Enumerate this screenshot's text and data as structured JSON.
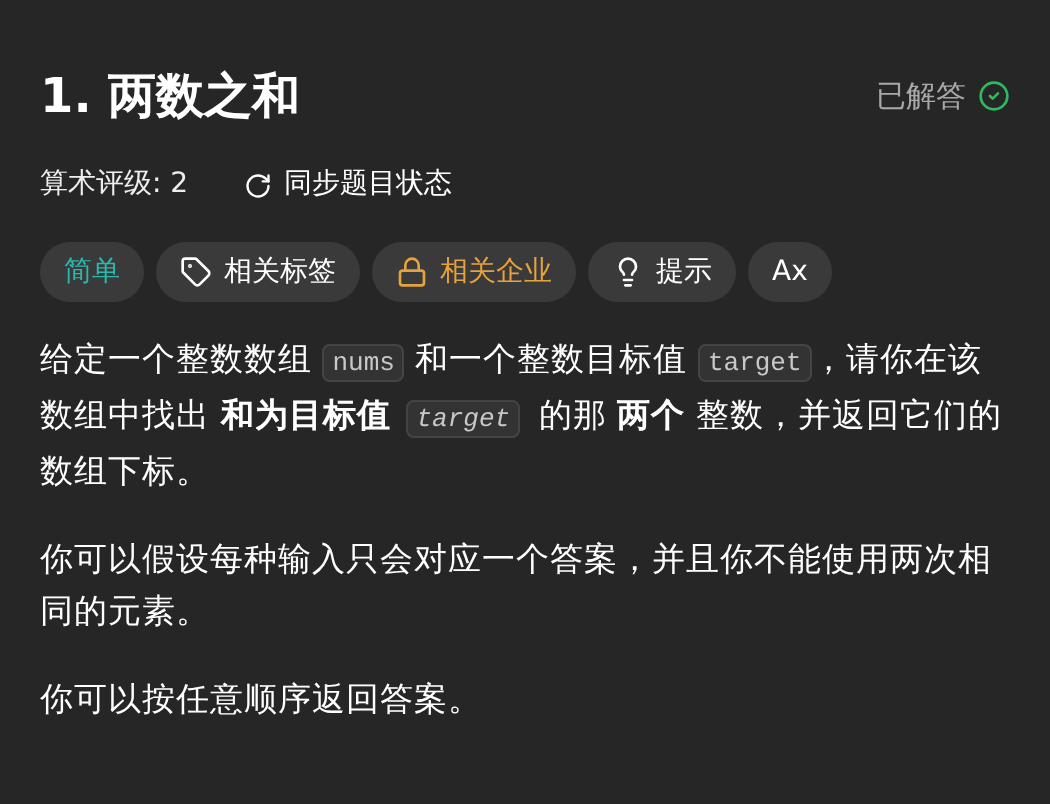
{
  "title": "1. 两数之和",
  "status": {
    "label": "已解答",
    "solved": true
  },
  "rating": {
    "label": "算术评级: 2"
  },
  "sync": {
    "label": "同步题目状态"
  },
  "tags": [
    {
      "kind": "difficulty",
      "label": "简单"
    },
    {
      "kind": "topics",
      "label": "相关标签"
    },
    {
      "kind": "companies",
      "label": "相关企业"
    },
    {
      "kind": "hint",
      "label": "提示"
    },
    {
      "kind": "translate",
      "label": "Ax"
    }
  ],
  "paragraphs": [
    [
      {
        "kind": "text",
        "text": "给定一个整数数组 "
      },
      {
        "kind": "code",
        "text": "nums"
      },
      {
        "kind": "text",
        "text": " 和一个整数目标值 "
      },
      {
        "kind": "code",
        "text": "target"
      },
      {
        "kind": "text",
        "text": "，请你在该数组中找出 "
      },
      {
        "kind": "bold",
        "text": "和为目标值"
      },
      {
        "kind": "code_italic",
        "text": "target"
      },
      {
        "kind": "text",
        "text": " 的那 "
      },
      {
        "kind": "bold",
        "text": "两个"
      },
      {
        "kind": "text",
        "text": " 整数，并返回它们的数组下标。"
      }
    ],
    [
      {
        "kind": "text",
        "text": "你可以假设每种输入只会对应一个答案，并且你不能使用两次相同的元素。"
      }
    ],
    [
      {
        "kind": "text",
        "text": "你可以按任意顺序返回答案。"
      }
    ]
  ]
}
